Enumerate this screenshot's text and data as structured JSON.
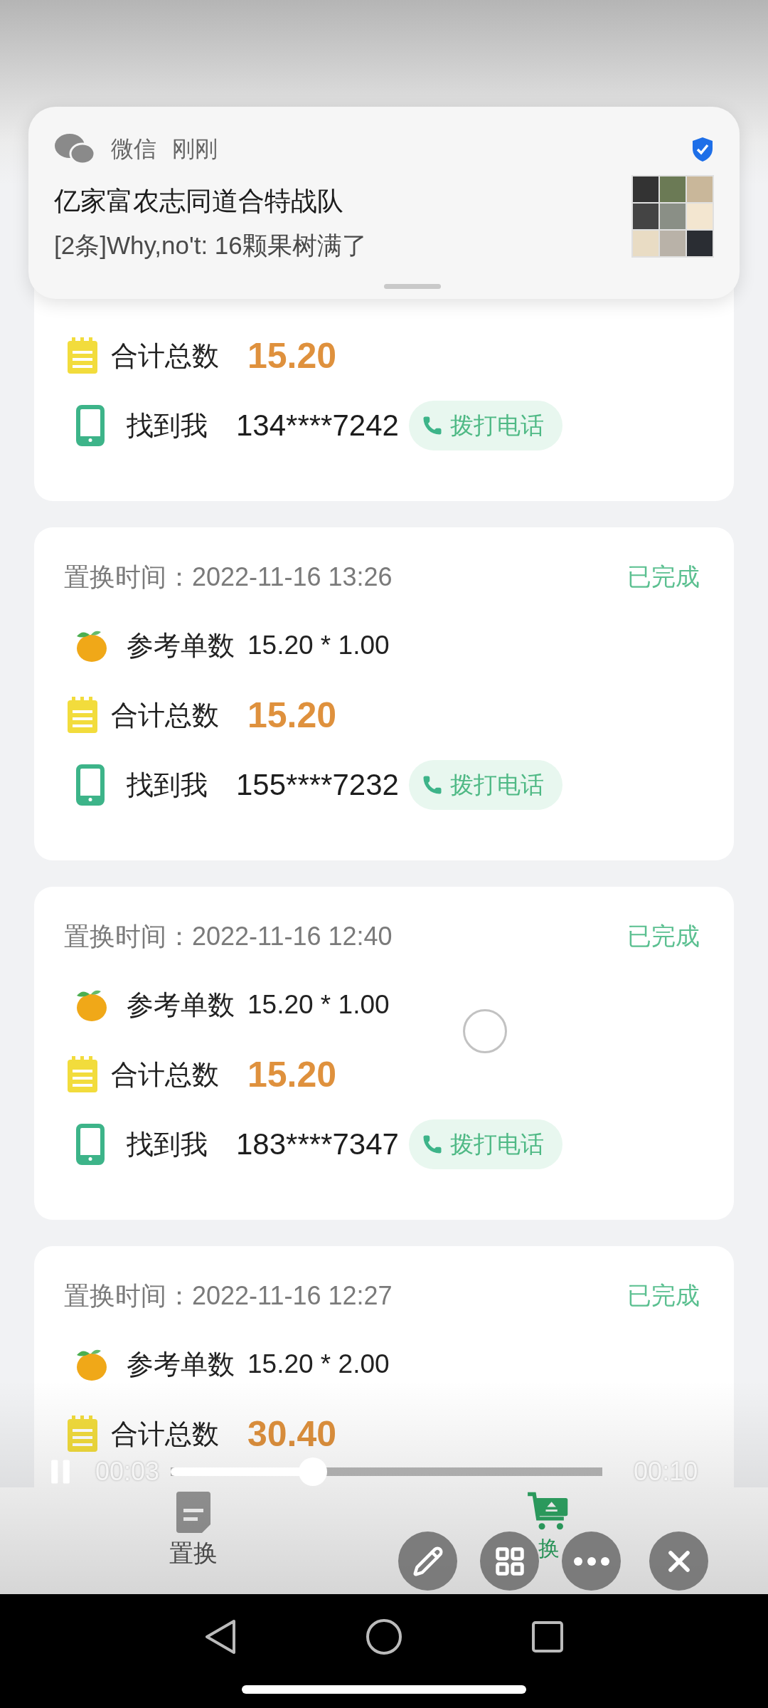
{
  "notification": {
    "app": "微信",
    "time": "刚刚",
    "title": "亿家富农志同道合特战队",
    "message": "[2条]Why,no't: 16颗果树满了"
  },
  "records": [
    {
      "total_label": "合计总数",
      "total": "15.20",
      "contact_label": "找到我",
      "phone": "134****7242",
      "call": "拨打电话"
    },
    {
      "time": "置换时间：2022-11-16 13:26",
      "status": "已完成",
      "ref_label": "参考单数",
      "ref": "15.20 * 1.00",
      "total_label": "合计总数",
      "total": "15.20",
      "contact_label": "找到我",
      "phone": "155****7232",
      "call": "拨打电话"
    },
    {
      "time": "置换时间：2022-11-16 12:40",
      "status": "已完成",
      "ref_label": "参考单数",
      "ref": "15.20 * 1.00",
      "total_label": "合计总数",
      "total": "15.20",
      "contact_label": "找到我",
      "phone": "183****7347",
      "call": "拨打电话"
    },
    {
      "time": "置换时间：2022-11-16 12:27",
      "status": "已完成",
      "ref_label": "参考单数",
      "ref": "15.20 * 2.00",
      "total_label": "合计总数",
      "total": "30.40"
    }
  ],
  "tabs": [
    {
      "label": "置换",
      "kind": "doc",
      "selected": false
    },
    {
      "label": "换",
      "kind": "cart",
      "selected": true
    }
  ],
  "player": {
    "playing": true,
    "elapsed": "00:03",
    "duration": "00:10",
    "level": 0.33
  }
}
